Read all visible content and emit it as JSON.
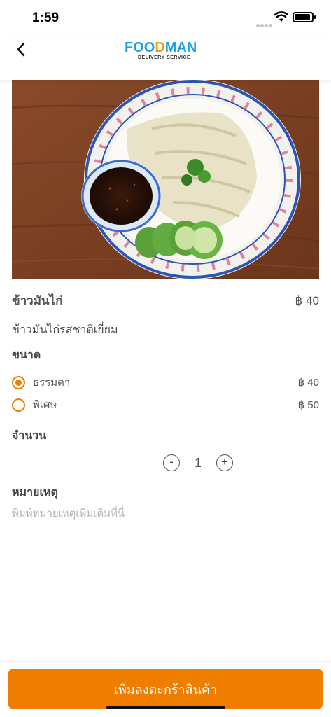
{
  "status_bar": {
    "time": "1:59"
  },
  "header": {
    "logo": {
      "word_part1": "FOO",
      "word_part2": "D",
      "word_part3": "MAN",
      "subtitle": "DELIVERY SERVICE"
    }
  },
  "item": {
    "name": "ข้าวมันไก่",
    "price": "฿ 40",
    "description": "ข้าวมันไก่รสชาติเยี่ยม"
  },
  "size_section": {
    "title": "ขนาด",
    "options": [
      {
        "label": "ธรรมดา",
        "price": "฿ 40",
        "selected": true
      },
      {
        "label": "พิเศษ",
        "price": "฿ 50",
        "selected": false
      }
    ]
  },
  "quantity_section": {
    "title": "จำนวน",
    "minus": "-",
    "value": "1",
    "plus": "+"
  },
  "note_section": {
    "title": "หมายเหตุ",
    "placeholder": "พิมพ์หมายเหตุเพิ่มเติมที่นี่",
    "value": ""
  },
  "add_to_cart_label": "เพิ่มลงตะกร้าสินค้า",
  "colors": {
    "accent": "#ef7d00",
    "logo_blue": "#1ca3e6",
    "logo_orange": "#f39c12"
  }
}
